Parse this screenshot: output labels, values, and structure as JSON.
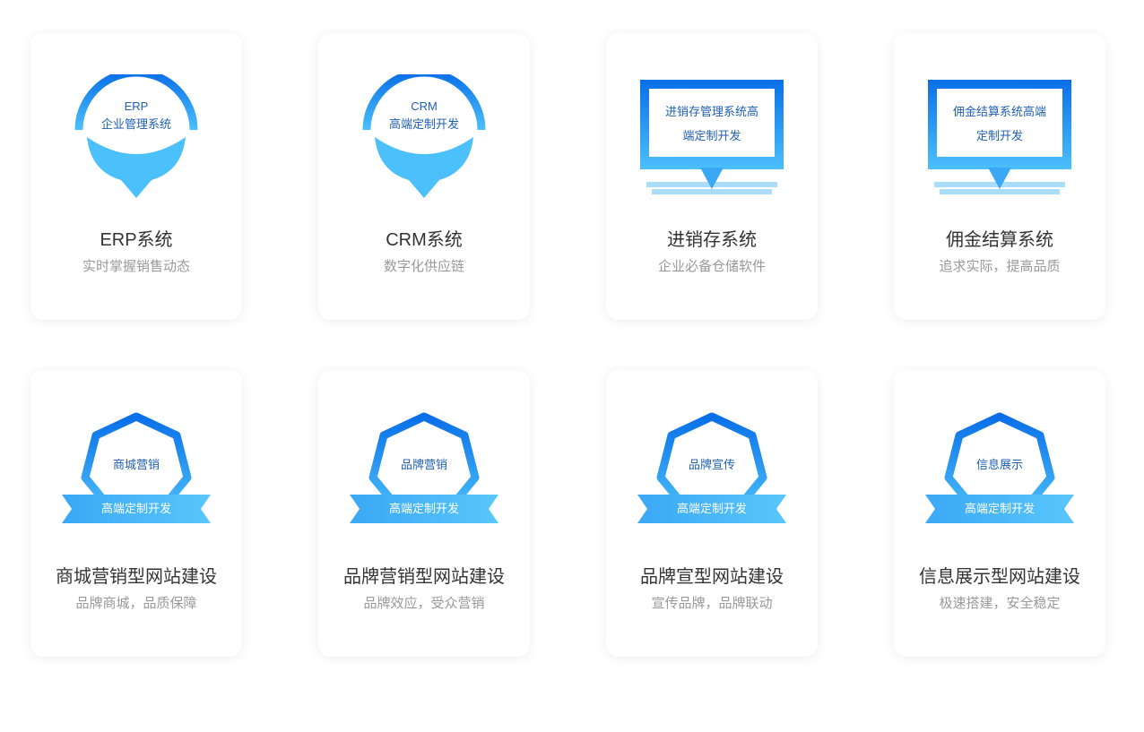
{
  "cards": [
    {
      "icon_line1": "ERP",
      "icon_line2": "企业管理系统",
      "title": "ERP系统",
      "subtitle": "实时掌握销售动态"
    },
    {
      "icon_line1": "CRM",
      "icon_line2": "高端定制开发",
      "title": "CRM系统",
      "subtitle": "数字化供应链"
    },
    {
      "icon_line1": "进销存管理系统高",
      "icon_line2": "端定制开发",
      "title": "进销存系统",
      "subtitle": "企业必备仓储软件"
    },
    {
      "icon_line1": "佣金结算系统高端",
      "icon_line2": "定制开发",
      "title": "佣金结算系统",
      "subtitle": "追求实际，提高品质"
    },
    {
      "icon_line1": "商城营销",
      "icon_line2": "高端定制开发",
      "title": "商城营销型网站建设",
      "subtitle": "品牌商城，品质保障"
    },
    {
      "icon_line1": "品牌营销",
      "icon_line2": "高端定制开发",
      "title": "品牌营销型网站建设",
      "subtitle": "品牌效应，受众营销"
    },
    {
      "icon_line1": "品牌宣传",
      "icon_line2": "高端定制开发",
      "title": "品牌宣型网站建设",
      "subtitle": "宣传品牌，品牌联动"
    },
    {
      "icon_line1": "信息展示",
      "icon_line2": "高端定制开发",
      "title": "信息展示型网站建设",
      "subtitle": "极速搭建，安全稳定"
    }
  ],
  "colors": {
    "primary_blue": "#0a6fe8",
    "light_blue": "#4cc0fb",
    "icon_text": "#1f5fb3",
    "title_text": "#333333",
    "subtitle_text": "#999999"
  }
}
